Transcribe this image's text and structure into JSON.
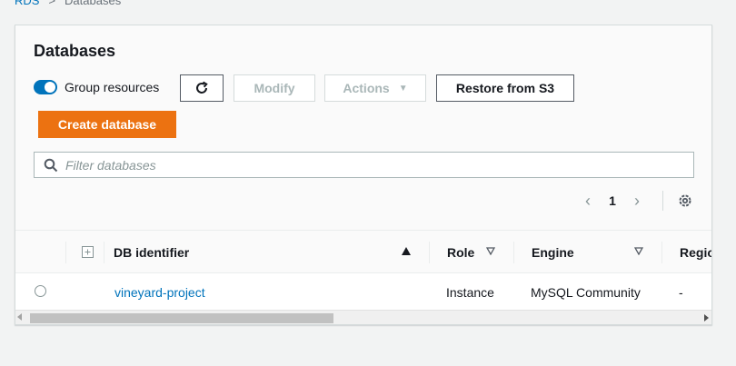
{
  "breadcrumb": {
    "root": "RDS",
    "current": "Databases"
  },
  "panel": {
    "title": "Databases"
  },
  "toolbar": {
    "group_resources_label": "Group resources",
    "group_resources_on": true,
    "modify_label": "Modify",
    "actions_label": "Actions",
    "restore_label": "Restore from S3",
    "create_label": "Create database"
  },
  "filter": {
    "placeholder": "Filter databases",
    "value": ""
  },
  "pagination": {
    "current_page": "1"
  },
  "table": {
    "columns": [
      "DB identifier",
      "Role",
      "Engine",
      "Regio"
    ],
    "sorted_column": "DB identifier",
    "rows": [
      {
        "db_identifier": "vineyard-project",
        "role": "Instance",
        "engine": "MySQL Community",
        "region": "-"
      }
    ]
  },
  "colors": {
    "accent": "#0073bb",
    "primary_button": "#ec7211",
    "text": "#16191f",
    "muted": "#879596"
  },
  "icons": [
    "refresh-icon",
    "caret-down-icon",
    "search-icon",
    "chevron-left-icon",
    "chevron-right-icon",
    "gear-icon",
    "expand-icon",
    "sort-up-icon",
    "sort-down-icon"
  ]
}
